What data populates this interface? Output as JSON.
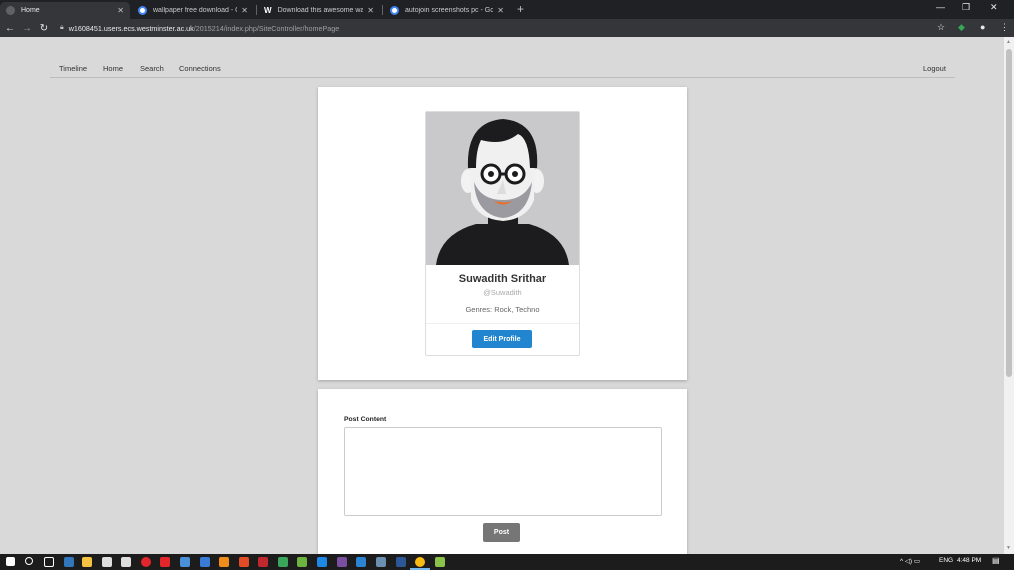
{
  "browser": {
    "tabs": [
      {
        "title": "Home",
        "active": true,
        "color": "#5f6368"
      },
      {
        "title": "wallpaper free download - Googl",
        "active": false,
        "color": "#4285f4"
      },
      {
        "title": "Download this awesome wallpap",
        "active": false,
        "color": "#ffffff"
      },
      {
        "title": "autojoin screenshots pc - Googl",
        "active": false,
        "color": "#4285f4"
      }
    ],
    "url_host": "w1608451.users.ecs.westminster.ac.uk",
    "url_path": "/2015214/index.php/SiteController/homePage"
  },
  "nav": {
    "items": [
      "Timeline",
      "Home",
      "Search",
      "Connections"
    ],
    "logout": "Logout"
  },
  "profile": {
    "name": "Suwadith Srithar",
    "handle": "@Suwadith",
    "genres": "Genres: Rock, Techno",
    "edit_label": "Edit Profile"
  },
  "post": {
    "label": "Post Content",
    "placeholder": "",
    "button": "Post"
  },
  "taskbar": {
    "language": "ENG",
    "time": "4:48 PM"
  },
  "colors": {
    "accent": "#2185d0",
    "post_button": "#767676"
  }
}
